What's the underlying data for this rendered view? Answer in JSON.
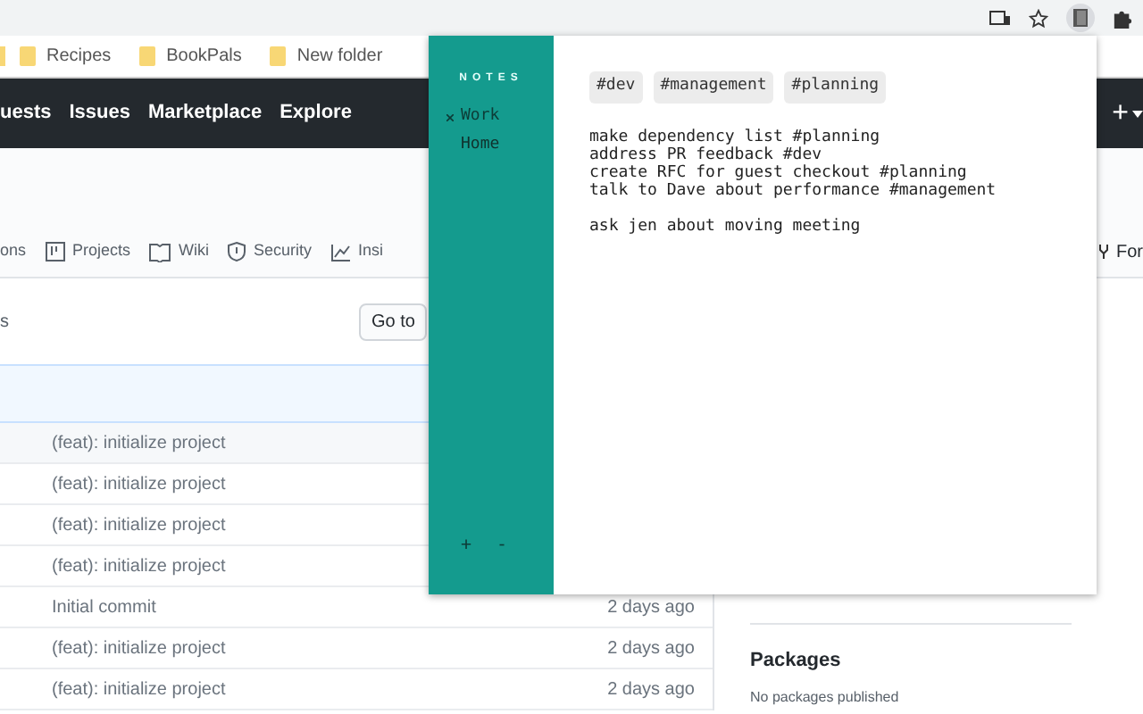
{
  "bookmarks": [
    "Recipes",
    "BookPals",
    "New folder"
  ],
  "header_nav": [
    "uests",
    "Issues",
    "Marketplace",
    "Explore"
  ],
  "header_new": "+",
  "repo_tabs": [
    "ons",
    "Projects",
    "Wiki",
    "Security",
    "Insi"
  ],
  "fork": "For",
  "branch_text": "s",
  "goto_button": "Go to",
  "commits": [
    {
      "message": "(feat): initialize project"
    },
    {
      "message": "(feat): initialize project"
    },
    {
      "message": "(feat): initialize project"
    },
    {
      "message": "(feat): initialize project"
    },
    {
      "message": "Initial commit",
      "time": "2 days ago"
    },
    {
      "message": "(feat): initialize project",
      "time": "2 days ago"
    },
    {
      "message": "(feat): initialize project",
      "time": "2 days ago"
    }
  ],
  "packages": {
    "title": "Packages",
    "text": "No packages published"
  },
  "notes_popup": {
    "title": "NOTES",
    "notebooks": [
      {
        "name": "Work",
        "selected": true
      },
      {
        "name": "Home",
        "selected": false
      }
    ],
    "add_button": "+",
    "remove_button": "-",
    "tags": [
      "#dev",
      "#management",
      "#planning"
    ],
    "blocks": [
      {
        "lines": [
          "make dependency list #planning",
          "address PR feedback #dev",
          "create RFC for guest checkout #planning",
          "talk to Dave about performance #management"
        ]
      },
      {
        "lines": [
          "ask jen about moving meeting"
        ]
      }
    ]
  }
}
